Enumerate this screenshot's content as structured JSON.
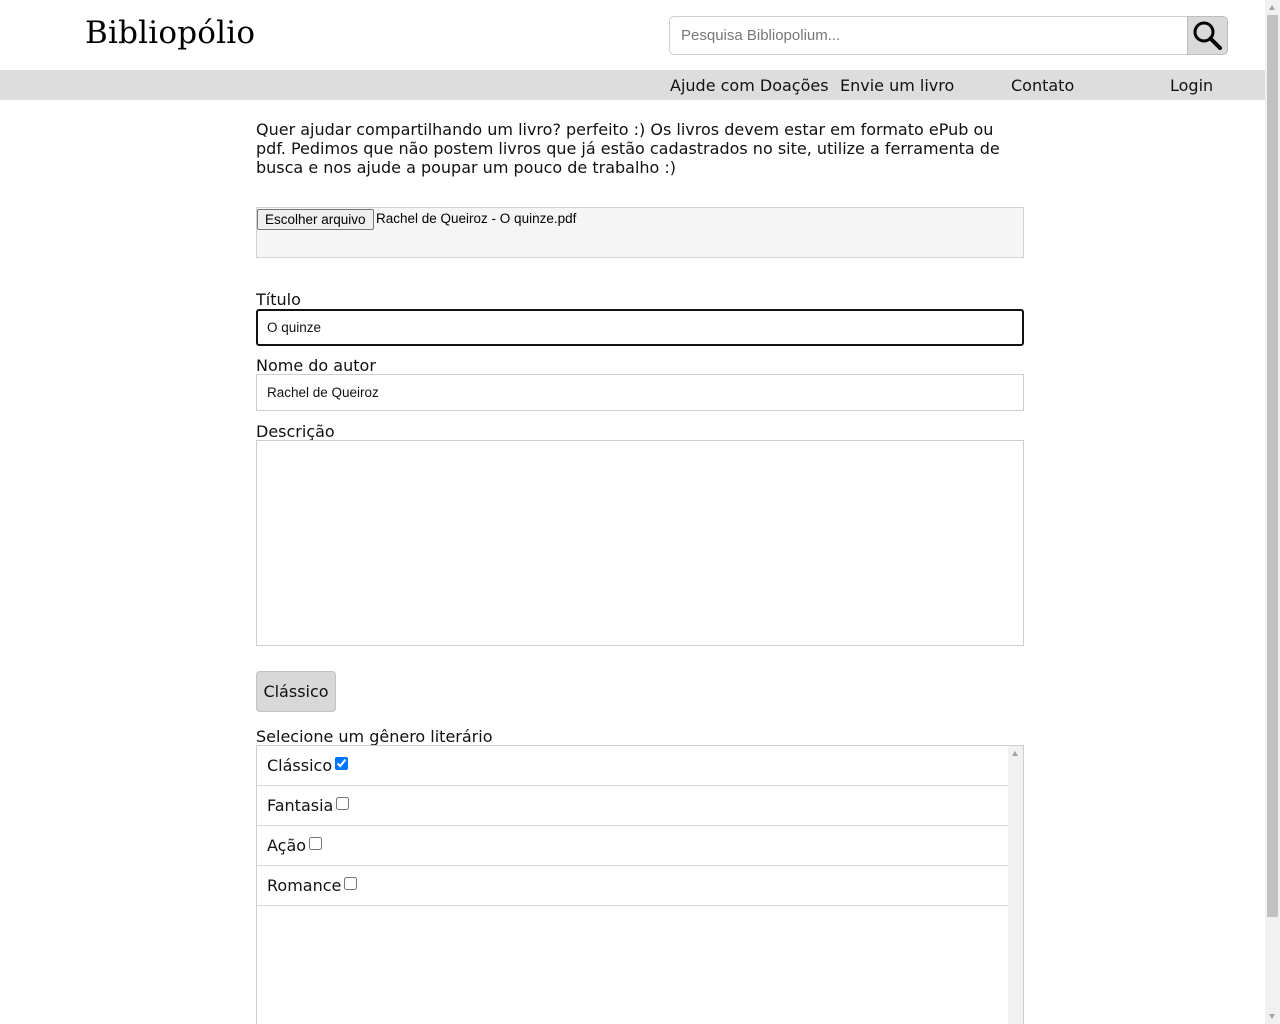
{
  "header": {
    "brand": "Bibliopólio",
    "search": {
      "placeholder": "Pesquisa Bibliopolium...",
      "value": "",
      "button_icon": "search-icon"
    }
  },
  "nav": {
    "items": [
      {
        "label": "Ajude com Doações"
      },
      {
        "label": "Envie um livro"
      },
      {
        "label": "Contato"
      },
      {
        "label": "Login"
      }
    ]
  },
  "form": {
    "intro": "Quer ajudar compartilhando um livro? perfeito :) Os livros devem estar em formato ePub ou pdf. Pedimos que não postem livros que já estão cadastrados no site, utilize a ferramenta de busca e nos ajude a poupar um pouco de trabalho :)",
    "file": {
      "button_label": "Escolher arquivo",
      "file_name": "Rachel de Queiroz - O quinze.pdf"
    },
    "title": {
      "label": "Título",
      "value": "O quinze"
    },
    "author": {
      "label": "Nome do autor",
      "value": "Rachel de Queiroz"
    },
    "description": {
      "label": "Descrição",
      "value": ""
    },
    "selected_genre_tag": "Clássico",
    "genre": {
      "label": "Selecione um gênero literário",
      "options": [
        {
          "label": "Clássico",
          "checked": true
        },
        {
          "label": "Fantasia",
          "checked": false
        },
        {
          "label": "Ação",
          "checked": false
        },
        {
          "label": "Romance",
          "checked": false
        }
      ]
    }
  }
}
